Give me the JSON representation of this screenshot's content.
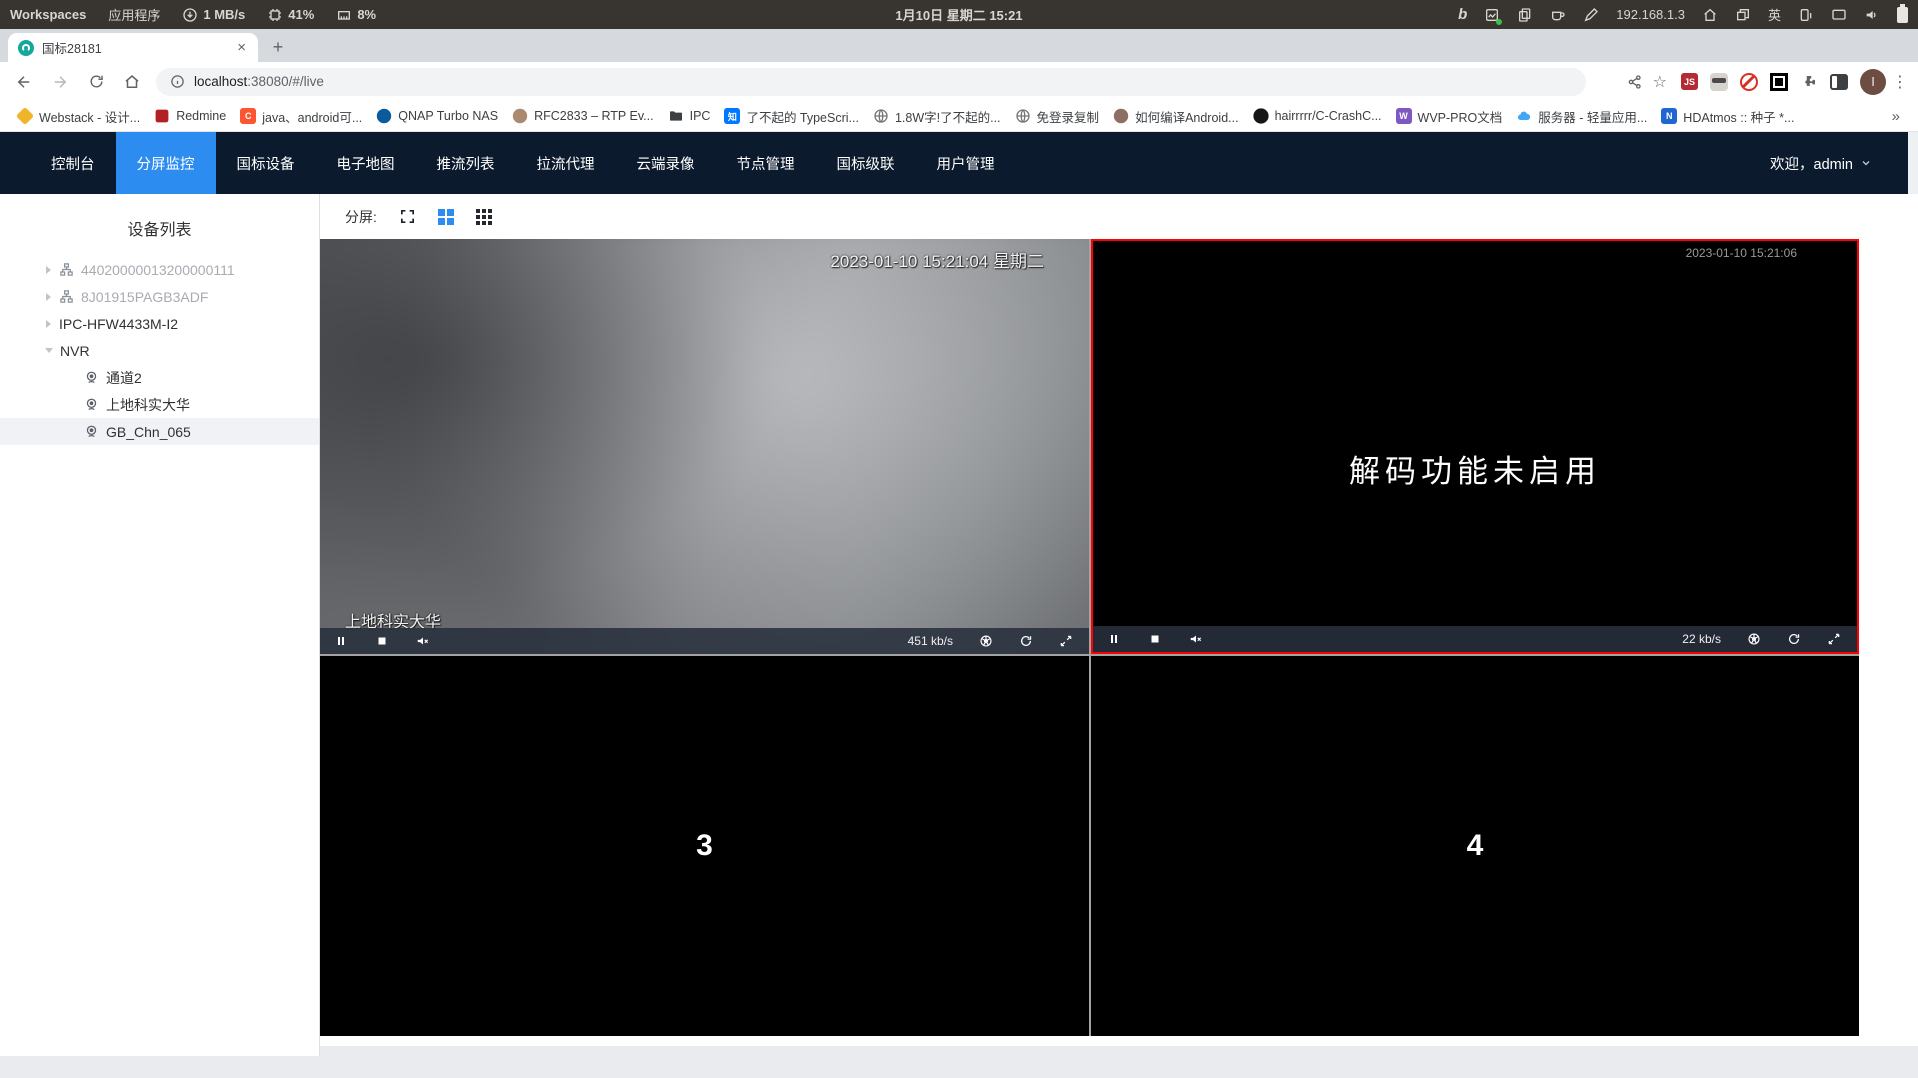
{
  "system_bar": {
    "workspaces": "Workspaces",
    "applications": "应用程序",
    "net_speed": "1 MB/s",
    "cpu": "41%",
    "memory": "8%",
    "clock": "1月10日 星期二 15:21",
    "bing": "b",
    "ip": "192.168.1.3",
    "ime": "英"
  },
  "browser": {
    "tab_title": "国标28181",
    "url_host": "localhost",
    "url_path": ":38080/#/live",
    "js_badge": "JS",
    "profile_initial": "I",
    "bookmarks": [
      {
        "label": "Webstack - 设计..."
      },
      {
        "label": "Redmine"
      },
      {
        "label": "java、android可..."
      },
      {
        "label": "QNAP Turbo NAS"
      },
      {
        "label": "RFC2833 – RTP Ev..."
      },
      {
        "label": "IPC"
      },
      {
        "label": "了不起的 TypeScri..."
      },
      {
        "label": "1.8W字!了不起的..."
      },
      {
        "label": "免登录复制"
      },
      {
        "label": "如何编译Android..."
      },
      {
        "label": "hairrrrr/C-CrashC..."
      },
      {
        "label": "WVP-PRO文档"
      },
      {
        "label": "服务器 - 轻量应用..."
      },
      {
        "label": "HDAtmos :: 种子 *..."
      }
    ],
    "csdn_letter": "C",
    "zhihu_letter": "知",
    "wvp_letter": "W",
    "hd_letter": "N"
  },
  "icons": {
    "close": "×",
    "new_tab": "+",
    "star": "☆",
    "kebab": "⋮",
    "overflow": "»"
  },
  "nav": {
    "items": [
      {
        "label": "控制台"
      },
      {
        "label": "分屏监控"
      },
      {
        "label": "国标设备"
      },
      {
        "label": "电子地图"
      },
      {
        "label": "推流列表"
      },
      {
        "label": "拉流代理"
      },
      {
        "label": "云端录像"
      },
      {
        "label": "节点管理"
      },
      {
        "label": "国标级联"
      },
      {
        "label": "用户管理"
      }
    ],
    "welcome": "欢迎，admin"
  },
  "sidebar": {
    "title": "设备列表",
    "tree": {
      "platform1": "44020000013200000111",
      "platform2": "8J01915PAGB3ADF",
      "device1": "IPC-HFW4433M-I2",
      "device2": "NVR",
      "channel1": "通道2",
      "channel2": "上地科实大华",
      "channel3": "GB_Chn_065"
    }
  },
  "toolbar": {
    "split_label": "分屏:"
  },
  "players": {
    "p1": {
      "timestamp": "2023-01-10 15:21:04 星期二",
      "name": "上地科实大华",
      "bitrate": "451 kb/s"
    },
    "p2": {
      "timestamp": "2023-01-10 15:21:06",
      "message": "解码功能未启用",
      "bitrate": "22 kb/s"
    },
    "p3": {
      "number": "3"
    },
    "p4": {
      "number": "4"
    }
  },
  "colors": {
    "accent_blue": "#2d8cf0",
    "nav_bg": "#0b1a2c",
    "selected_border": "#ff0000"
  }
}
